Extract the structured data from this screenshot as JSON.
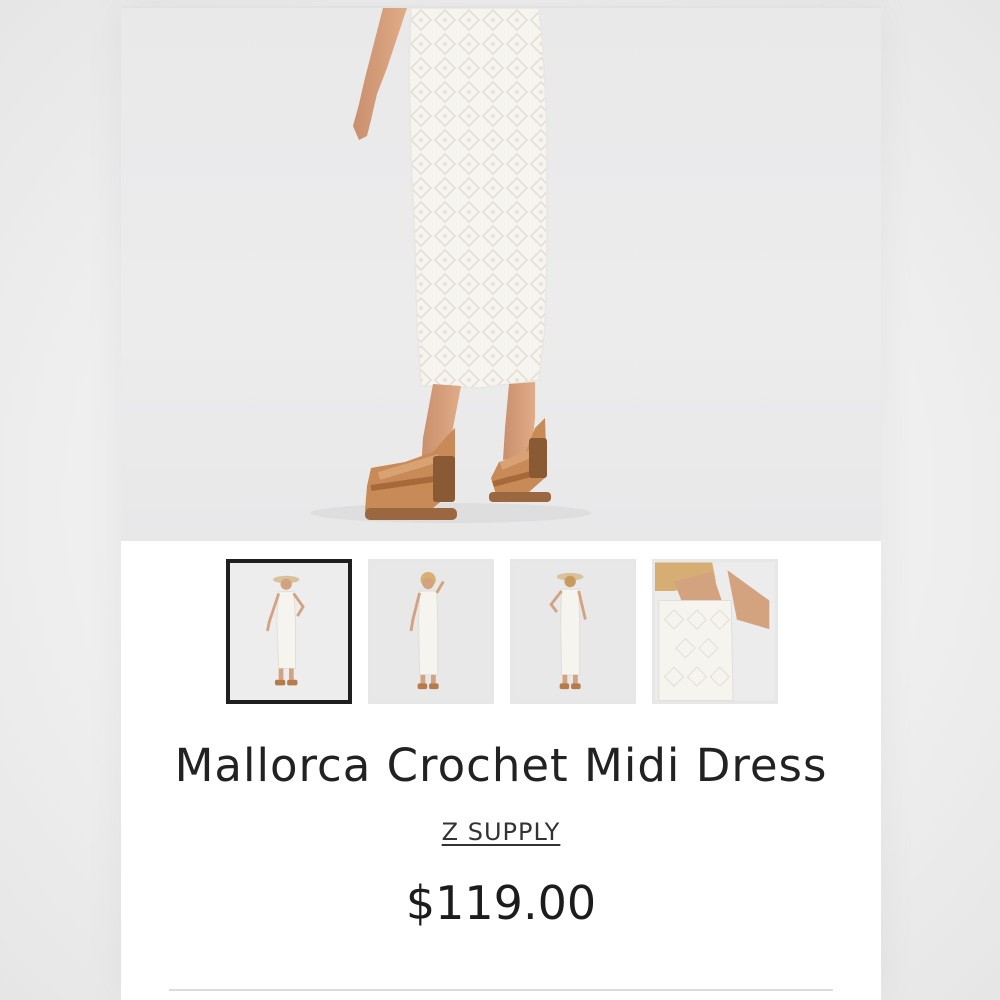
{
  "product": {
    "title": "Mallorca Crochet Midi Dress",
    "brand": "Z SUPPLY",
    "price": "$119.00"
  },
  "gallery": {
    "active_index": 0,
    "thumbnails": [
      {
        "view": "front-full-with-hat"
      },
      {
        "view": "front-full"
      },
      {
        "view": "back-full"
      },
      {
        "view": "neckline-detail"
      }
    ]
  },
  "colors": {
    "text": "#222222",
    "active_thumb_border": "#1f1f1f",
    "photo_background": "#ebebec"
  }
}
